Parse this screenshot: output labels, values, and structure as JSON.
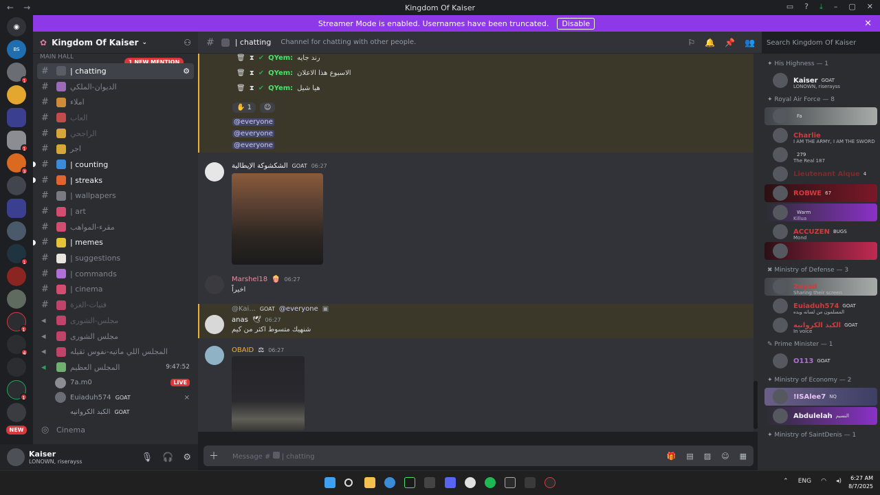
{
  "window": {
    "title": "Kingdom Of Kaiser",
    "back_icon": "←",
    "forward_icon": "→"
  },
  "banner": {
    "text": "Streamer Mode is enabled. Usernames have been truncated.",
    "disable_label": "Disable",
    "close_icon": "✕"
  },
  "guilds": {
    "badges": [
      "1",
      "1",
      "3",
      "1",
      "1",
      "4",
      "1",
      "1"
    ],
    "new_label": "NEW"
  },
  "server": {
    "name": "Kingdom Of Kaiser",
    "category": "MAIN HALL",
    "mention_pill": "1 NEW MENTION",
    "channels": [
      {
        "name": "| chatting",
        "emoji": "#8e8e93"
      },
      {
        "name": "الديوان-الملكي",
        "emoji": "#9c6bb7"
      },
      {
        "name": "املاء",
        "emoji": "#d08b3a"
      },
      {
        "name": "العاب",
        "emoji": "#c24b4b"
      },
      {
        "name": "الراجحي",
        "emoji": "#d6a63b"
      },
      {
        "name": "اجر",
        "emoji": "#d6a63b"
      },
      {
        "name": "| counting",
        "emoji": "#3c8bd9"
      },
      {
        "name": "| streaks",
        "emoji": "#e0652f"
      },
      {
        "name": "| wallpapers",
        "emoji": "#7a7a82"
      },
      {
        "name": "| art",
        "emoji": "#d24d6f"
      },
      {
        "name": "مقرء-المواهب",
        "emoji": "#d24d6f"
      },
      {
        "name": "| memes",
        "emoji": "#e6c13a"
      },
      {
        "name": "| suggestions",
        "emoji": "#e9e5df"
      },
      {
        "name": "| commands",
        "emoji": "#b06fd6"
      },
      {
        "name": "| cinema",
        "emoji": "#d24d6f"
      },
      {
        "name": "فتيات-الغزة",
        "emoji": "#c0436a"
      },
      {
        "name": "مجلس-الشورى",
        "emoji": "#c0436a"
      },
      {
        "name": "مجلس الشورى",
        "emoji": "#c0436a"
      },
      {
        "name": "المجلس اللي ماتيه-نفوس ثقيله",
        "emoji": "#c0436a"
      },
      {
        "name": "المجلس العظيم",
        "emoji": "#6fb06f",
        "timer": "9:47:52"
      }
    ],
    "voice_users": [
      {
        "name": "7a.m0",
        "live": "LIVE"
      },
      {
        "name": "Euiaduh574",
        "goat": "GOAT"
      },
      {
        "name": "الكبد الكروانيه",
        "goat": "GOAT"
      }
    ],
    "cinema_label": "Cinema"
  },
  "user_panel": {
    "name": "Kaiser",
    "status": "LONOWN, riserayss"
  },
  "chat": {
    "channel": "| chatting",
    "topic": "Channel for chatting with other people.",
    "search_placeholder": "Search Kingdom Of Kaiser",
    "composer_placeholder": "Message #",
    "composer_channel": "| chatting",
    "embed_rows": [
      {
        "user": "QYem:",
        "text": "رند جايه"
      },
      {
        "user": "QYem:",
        "text": "الاسبوع هذا الاعلان"
      },
      {
        "user": "QYem:",
        "text": "هيا شيل"
      }
    ],
    "reaction": {
      "emoji": "✋",
      "count": "1"
    },
    "everyone": [
      "@everyone",
      "@everyone",
      "@everyone"
    ],
    "messages": [
      {
        "author": "الشكشوكة الإيطالية",
        "goat": "GOAT",
        "time": "06:27"
      },
      {
        "author": "Marshel18",
        "time": "06:27",
        "text": "اخيراً"
      },
      {
        "reply_to": "@Kai...",
        "reply_goat": "GOAT",
        "reply_mention": "@everyone",
        "author": "anas",
        "time": "06:27",
        "text": "شنهيك متسوط اكثر من كيم"
      },
      {
        "author": "OBAID",
        "time": "06:27"
      }
    ]
  },
  "members": {
    "roles": [
      {
        "label": "His Highness — 1",
        "color": "#949ba4"
      },
      {
        "label": "Royal Air Force — 8",
        "color": "#949ba4"
      },
      {
        "label": "Ministry of Defense — 3",
        "color": "#949ba4"
      },
      {
        "label": "Prime Minister — 1",
        "color": "#949ba4"
      },
      {
        "label": "Ministry of Economy — 2",
        "color": "#949ba4"
      },
      {
        "label": "Ministry of SaintDenis — 1",
        "color": "#949ba4"
      }
    ],
    "list": [
      {
        "name": "Kaiser",
        "tag": "GOAT",
        "sub": "LONOWN, riserayss",
        "color": "#f2f3f5"
      },
      {
        "name": "",
        "tag": "Fa",
        "color": "#da373c",
        "bg": "linear-gradient(90deg,#3f4348,#a8aca9)"
      },
      {
        "name": "Charlie",
        "sub": "I AM THE ARMY, I AM THE SWORD",
        "color": "#da373c"
      },
      {
        "name": "",
        "tag": "279",
        "sub": "The Real 187",
        "color": "#da373c"
      },
      {
        "name": "Lieutenant Alque",
        "tag": "4",
        "color": "#7e2b2b"
      },
      {
        "name": "ROBWE",
        "tag": "67",
        "color": "#da373c",
        "bg": "linear-gradient(90deg,#2b1114,#7a1828)"
      },
      {
        "name": "",
        "tag": "Warm",
        "sub": "Killua",
        "color": "#f2f3f5",
        "bg": "linear-gradient(90deg,#2b2d31,#8a31c7)"
      },
      {
        "name": "ACCUZEN",
        "tag": "BUGS",
        "sub": "Mond",
        "color": "#da373c"
      },
      {
        "name": "",
        "color": "#da373c",
        "bg": "linear-gradient(90deg,#2a1016,#c12a52)"
      },
      {
        "name": "Zeyad",
        "sub": "Sharing their screen",
        "color": "#da373c",
        "bg": "linear-gradient(90deg,#3f4348,#a8aca9)"
      },
      {
        "name": "Euiaduh574",
        "tag": "GOAT",
        "sub": "المسلمون من لسانه ويده",
        "color": "#da373c"
      },
      {
        "name": "الكبد الكروانيه",
        "tag": "GOAT",
        "sub": "In voice",
        "color": "#da373c"
      },
      {
        "name": "O113",
        "tag": "GOAT",
        "color": "#b06fd6"
      },
      {
        "name": "!ISAlee7",
        "tag": "NQ",
        "color": "#e7c2f5",
        "bg": "linear-gradient(90deg,#6b5f87,#3d3f64)"
      },
      {
        "name": "Abdulelah",
        "tag": "النسيم",
        "color": "#f2f3f5",
        "bg": "linear-gradient(90deg,#2b2d31,#8a31c7)"
      }
    ]
  },
  "taskbar": {
    "lang": "ENG",
    "time": "6:27 AM",
    "date": "8/7/2025"
  }
}
